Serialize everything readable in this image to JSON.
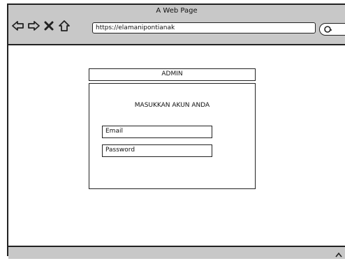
{
  "window": {
    "title": "A Web Page"
  },
  "address_bar": {
    "url": "https://elamanipontianak"
  },
  "icons": {
    "back": "back-arrow-icon",
    "forward": "forward-arrow-icon",
    "close": "close-icon",
    "home": "home-icon",
    "search": "search-icon",
    "scroll": "caret-up-icon"
  },
  "login": {
    "header": "ADMIN",
    "title": "MASUKKAN AKUN ANDA",
    "email_placeholder": "Email",
    "password_placeholder": "Password"
  },
  "colors": {
    "chrome": "#c8c8c8",
    "stroke": "#222222",
    "page": "#ffffff"
  }
}
